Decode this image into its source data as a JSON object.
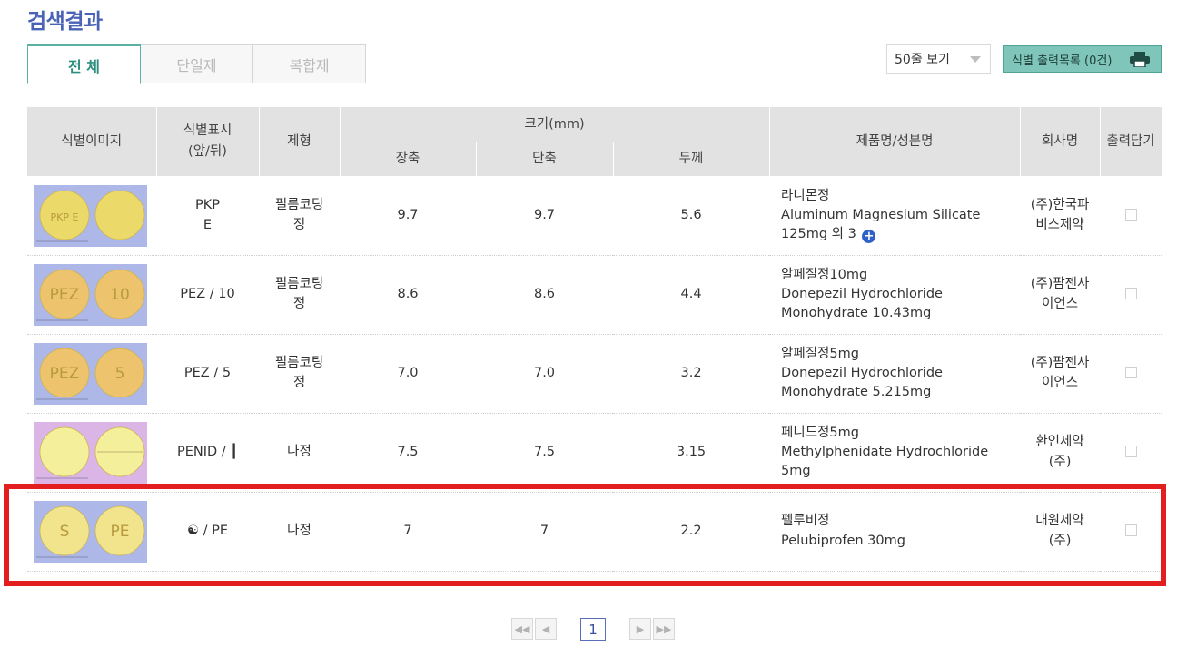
{
  "header": {
    "title": "검색결과"
  },
  "tabs": [
    {
      "label": "전 체"
    },
    {
      "label": "단일제"
    },
    {
      "label": "복합제"
    }
  ],
  "controls": {
    "view_select": "50줄 보기",
    "print_list_label": "식별 출력목록 (0건)"
  },
  "table": {
    "headers": {
      "image": "식별이미지",
      "marking_line1": "식별표시",
      "marking_line2": "(앞/뒤)",
      "form": "제형",
      "size": "크기(mm)",
      "long": "장축",
      "short": "단축",
      "thickness": "두께",
      "product": "제품명/성분명",
      "company": "회사명",
      "cart": "출력담기"
    },
    "rows": [
      {
        "front": "PKP",
        "back": "E",
        "pill_front_text": "PKP E",
        "pill_back_text": "",
        "pill_color": "#ebd969",
        "bg": "#aeb8e8",
        "form_line1": "필름코팅",
        "form_line2": "정",
        "long": "9.7",
        "short": "9.7",
        "thickness": "5.6",
        "name": "라니몬정",
        "ingredient": "Aluminum Magnesium Silicate",
        "dose": "125mg 외 3",
        "company_line1": "(주)한국파",
        "company_line2": "비스제약"
      },
      {
        "front": "PEZ / 10",
        "back": "",
        "pill_front_text": "PEZ",
        "pill_back_text": "10",
        "pill_color": "#edc36d",
        "bg": "#aeb8e8",
        "form_line1": "필름코팅",
        "form_line2": "정",
        "long": "8.6",
        "short": "8.6",
        "thickness": "4.4",
        "name": "알페질정10mg",
        "ingredient": "Donepezil Hydrochloride",
        "dose": "Monohydrate   10.43mg",
        "company_line1": "(주)팜젠사",
        "company_line2": "이언스"
      },
      {
        "front": "PEZ / 5",
        "back": "",
        "pill_front_text": "PEZ",
        "pill_back_text": "5",
        "pill_color": "#edc36d",
        "bg": "#aeb8e8",
        "form_line1": "필름코팅",
        "form_line2": "정",
        "long": "7.0",
        "short": "7.0",
        "thickness": "3.2",
        "name": "알페질정5mg",
        "ingredient": "Donepezil Hydrochloride",
        "dose": "Monohydrate   5.215mg",
        "company_line1": "(주)팜젠사",
        "company_line2": "이언스"
      },
      {
        "front": "PENID / ┃",
        "back": "",
        "pill_front_text": "",
        "pill_back_text": "",
        "pill_color": "#f4ef9a",
        "bg": "#dbb5e6",
        "form_line1": "나정",
        "form_line2": "",
        "long": "7.5",
        "short": "7.5",
        "thickness": "3.15",
        "name": "페니드정5mg",
        "ingredient": "Methylphenidate Hydrochloride",
        "dose": "5mg",
        "company_line1": "환인제약",
        "company_line2": "(주)"
      },
      {
        "front": "☯  / PE",
        "back": "",
        "pill_front_text": "S",
        "pill_back_text": "PE",
        "pill_color": "#f2e48c",
        "bg": "#aeb8e8",
        "form_line1": "나정",
        "form_line2": "",
        "long": "7",
        "short": "7",
        "thickness": "2.2",
        "name": "펠루비정",
        "ingredient": "Pelubiprofen    30mg",
        "dose": "",
        "company_line1": "대원제약",
        "company_line2": "(주)"
      }
    ]
  },
  "pagination": {
    "current": "1",
    "first": "◀◀",
    "prev": "◀",
    "next": "▶",
    "last": "▶▶"
  }
}
